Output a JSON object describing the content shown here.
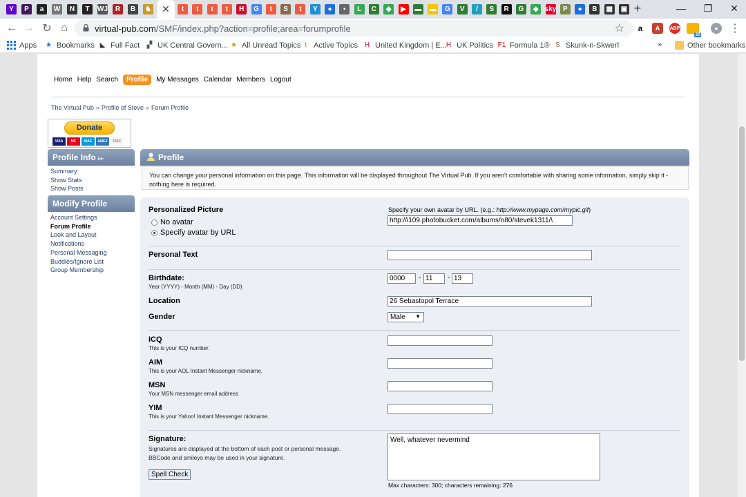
{
  "browser": {
    "tabs": [
      {
        "icon": "yahoo-icon",
        "glyph": "Y",
        "color": "#5f01d1"
      },
      {
        "icon": "premier-league-icon",
        "glyph": "P",
        "color": "#3d195b"
      },
      {
        "icon": "amazon-icon",
        "glyph": "a",
        "color": "#222222"
      },
      {
        "icon": "wikipedia-icon",
        "glyph": "W",
        "color": "#777777"
      },
      {
        "icon": "nytimes-icon",
        "glyph": "N",
        "color": "#333333"
      },
      {
        "icon": "telegraph-icon",
        "glyph": "T",
        "color": "#222222"
      },
      {
        "icon": "wsj-icon",
        "glyph": "WJ",
        "color": "#555555"
      },
      {
        "icon": "radio-icon",
        "glyph": "R",
        "color": "#b22222"
      },
      {
        "icon": "bbc-icon",
        "glyph": "B",
        "color": "#444444"
      },
      {
        "icon": "chess-icon",
        "glyph": "♞",
        "color": "#c89b2a"
      },
      {
        "icon": "tumblr-icon",
        "glyph": "t",
        "color": "#ef5b3f"
      },
      {
        "icon": "tumblr-icon",
        "glyph": "t",
        "color": "#ef5b3f"
      },
      {
        "icon": "tumblr-icon",
        "glyph": "t",
        "color": "#ef5b3f"
      },
      {
        "icon": "tumblr-icon",
        "glyph": "t",
        "color": "#ef5b3f"
      },
      {
        "icon": "parliament-icon",
        "glyph": "H",
        "color": "#c8102e"
      },
      {
        "icon": "google-icon",
        "glyph": "G",
        "color": "#4285f4"
      },
      {
        "icon": "tumblr-icon",
        "glyph": "t",
        "color": "#ef5b3f"
      },
      {
        "icon": "skunk-icon",
        "glyph": "S",
        "color": "#8a6a4a"
      },
      {
        "icon": "tumblr-icon",
        "glyph": "t",
        "color": "#ef5b3f"
      },
      {
        "icon": "yammer-icon",
        "glyph": "Y",
        "color": "#1e90d6"
      },
      {
        "icon": "blue-globe-icon",
        "glyph": "●",
        "color": "#1e6fd9"
      },
      {
        "icon": "grey-square-icon",
        "glyph": "▪",
        "color": "#666666"
      },
      {
        "icon": "lime-icon",
        "glyph": "L",
        "color": "#34a853"
      },
      {
        "icon": "calculator-icon",
        "glyph": "C",
        "color": "#2e7d32"
      },
      {
        "icon": "maps-icon",
        "glyph": "◆",
        "color": "#34a853"
      },
      {
        "icon": "youtube-icon",
        "glyph": "▶",
        "color": "#ff0000"
      },
      {
        "icon": "ticket-icon",
        "glyph": "▬",
        "color": "#2e7d32"
      },
      {
        "icon": "yellow-icon",
        "glyph": "▬",
        "color": "#f6c400"
      },
      {
        "icon": "google-icon",
        "glyph": "G",
        "color": "#4285f4"
      },
      {
        "icon": "shield-icon",
        "glyph": "V",
        "color": "#2e7d32"
      },
      {
        "icon": "feather-icon",
        "glyph": "/",
        "color": "#20a0c0"
      },
      {
        "icon": "leaf-icon",
        "glyph": "S",
        "color": "#2e7d32"
      },
      {
        "icon": "race-icon",
        "glyph": "R",
        "color": "#111111"
      },
      {
        "icon": "gecko-icon",
        "glyph": "G",
        "color": "#2e7d32"
      },
      {
        "icon": "maps-icon",
        "glyph": "◆",
        "color": "#34a853"
      },
      {
        "icon": "sky-icon",
        "glyph": "sky",
        "color": "#e4002b"
      },
      {
        "icon": "portrait-icon",
        "glyph": "P",
        "color": "#7a8a4a"
      },
      {
        "icon": "blue-globe-icon",
        "glyph": "●",
        "color": "#1e6fd9"
      },
      {
        "icon": "briefcase-icon",
        "glyph": "B",
        "color": "#333333"
      },
      {
        "icon": "film-icon",
        "glyph": "▦",
        "color": "#333333"
      },
      {
        "icon": "monitor-icon",
        "glyph": "▣",
        "color": "#333333"
      }
    ],
    "active_tab_close": "✕",
    "new_tab": "+",
    "window_controls": {
      "minimize": "—",
      "restore": "❐",
      "close": "✕"
    },
    "url_host": "virtual-pub.com",
    "url_path": "/SMF/index.php?action=profile;area=forumprofile",
    "badge_count": "30"
  },
  "bookmarks": {
    "apps": "Apps",
    "items": [
      {
        "label": "Bookmarks",
        "icon": "star-icon",
        "glyph": "★",
        "color": "#1a73e8"
      },
      {
        "label": "Full Fact",
        "icon": "fullfact-icon",
        "glyph": "◣",
        "color": "#333333"
      },
      {
        "label": "UK Central Govern...",
        "icon": "gov-icon",
        "glyph": "▞",
        "color": "#555555"
      },
      {
        "label": "All Unread Topics",
        "icon": "forum-icon",
        "glyph": "★",
        "color": "#c89b2a"
      },
      {
        "label": "Active Topics",
        "icon": "tumblr-icon",
        "glyph": "t",
        "color": "#ef5b3f"
      },
      {
        "label": "United Kingdom | E...",
        "icon": "parliament-icon",
        "glyph": "H",
        "color": "#c8102e"
      },
      {
        "label": "UK Politics",
        "icon": "parliament-icon",
        "glyph": "H",
        "color": "#c8102e"
      },
      {
        "label": "Formula 1®",
        "icon": "f1-icon",
        "glyph": "F1",
        "color": "#e10600"
      },
      {
        "label": "Skunk-n-Skwerl",
        "icon": "skunk-icon",
        "glyph": "S",
        "color": "#8a6a4a"
      }
    ],
    "overflow": "»",
    "other": "Other bookmarks"
  },
  "forum": {
    "menu": [
      "Home",
      "Help",
      "Search",
      "Profile",
      "My Messages",
      "Calendar",
      "Members",
      "Logout"
    ],
    "active_menu": "Profile",
    "breadcrumb": [
      "The Virtual Pub",
      "Profile of Steve",
      "Forum Profile"
    ],
    "breadcrumb_sep": "»",
    "donate": {
      "label": "Donate",
      "cards": [
        "VISA",
        "MC",
        "MAE",
        "AMEX",
        "DISC"
      ]
    },
    "sidebar": {
      "profile_info_title": "Profile Info",
      "profile_info_links": [
        "Summary",
        "Show Stats",
        "Show Posts"
      ],
      "modify_title": "Modify Profile",
      "modify_links": [
        "Account Settings",
        "Forum Profile",
        "Look and Layout",
        "Notifications",
        "Personal Messaging",
        "Buddies/Ignore List",
        "Group Membership"
      ],
      "current": "Forum Profile"
    },
    "main_title": "Profile",
    "notice": "You can change your personal information on this page. This information will be displayed throughout The Virtual Pub. If you aren't comfortable with sharing some information, simply skip it - nothing here is required.",
    "form": {
      "picture_label": "Personalized Picture",
      "no_avatar": "No avatar",
      "specify_avatar": "Specify avatar by URL",
      "avatar_hint_prefix": "Specify your own avatar by URL. (e.g.: ",
      "avatar_hint_example": "http://www.mypage.com/mypic.gif",
      "avatar_hint_suffix": ")",
      "avatar_url": "http://i109.photobucket.com/albums/n80/stevek1311/\\",
      "personal_text_label": "Personal Text",
      "personal_text": "",
      "birthdate_label": "Birthdate:",
      "birthdate_hint": "Year (YYYY) - Month (MM) - Day (DD)",
      "birth_year": "0000",
      "birth_month": "11",
      "birth_day": "13",
      "date_sep": "-",
      "location_label": "Location",
      "location": "26 Sebastopol Terrace",
      "gender_label": "Gender",
      "gender": "Male",
      "icq_label": "ICQ",
      "icq_hint": "This is your ICQ number.",
      "icq": "",
      "aim_label": "AIM",
      "aim_hint": "This is your AOL Instant Messenger nickname.",
      "aim": "",
      "msn_label": "MSN",
      "msn_hint": "Your MSN messenger email address",
      "msn": "",
      "yim_label": "YIM",
      "yim_hint": "This is your Yahoo! Instant Messenger nickname.",
      "yim": "",
      "signature_label": "Signature:",
      "signature_hint": "Signatures are displayed at the bottom of each post or personal message. BBCode and smileys may be used in your signature.",
      "signature": "Well, whatever nevermind",
      "spell_check": "Spell Check",
      "char_count": "Max characters: 300; characters remaining: 276"
    }
  }
}
